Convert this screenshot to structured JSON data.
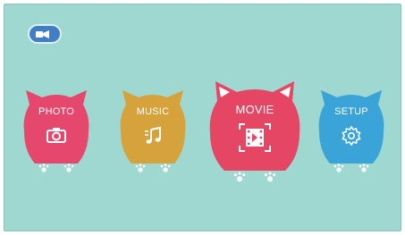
{
  "input_source": {
    "icon": "input-source-icon",
    "color": "#3f7fc5"
  },
  "menu": {
    "items": [
      {
        "label": "PHOTO",
        "icon": "camera-icon",
        "color": "#e6476c"
      },
      {
        "label": "MUSIC",
        "icon": "music-note-icon",
        "color": "#d6a23b"
      },
      {
        "label": "MOVIE",
        "icon": "film-icon",
        "color": "#e54664",
        "selected": true
      },
      {
        "label": "SETUP",
        "icon": "gear-icon",
        "color": "#3aa3d8"
      }
    ]
  },
  "colors": {
    "background": "#9ed8d0"
  }
}
